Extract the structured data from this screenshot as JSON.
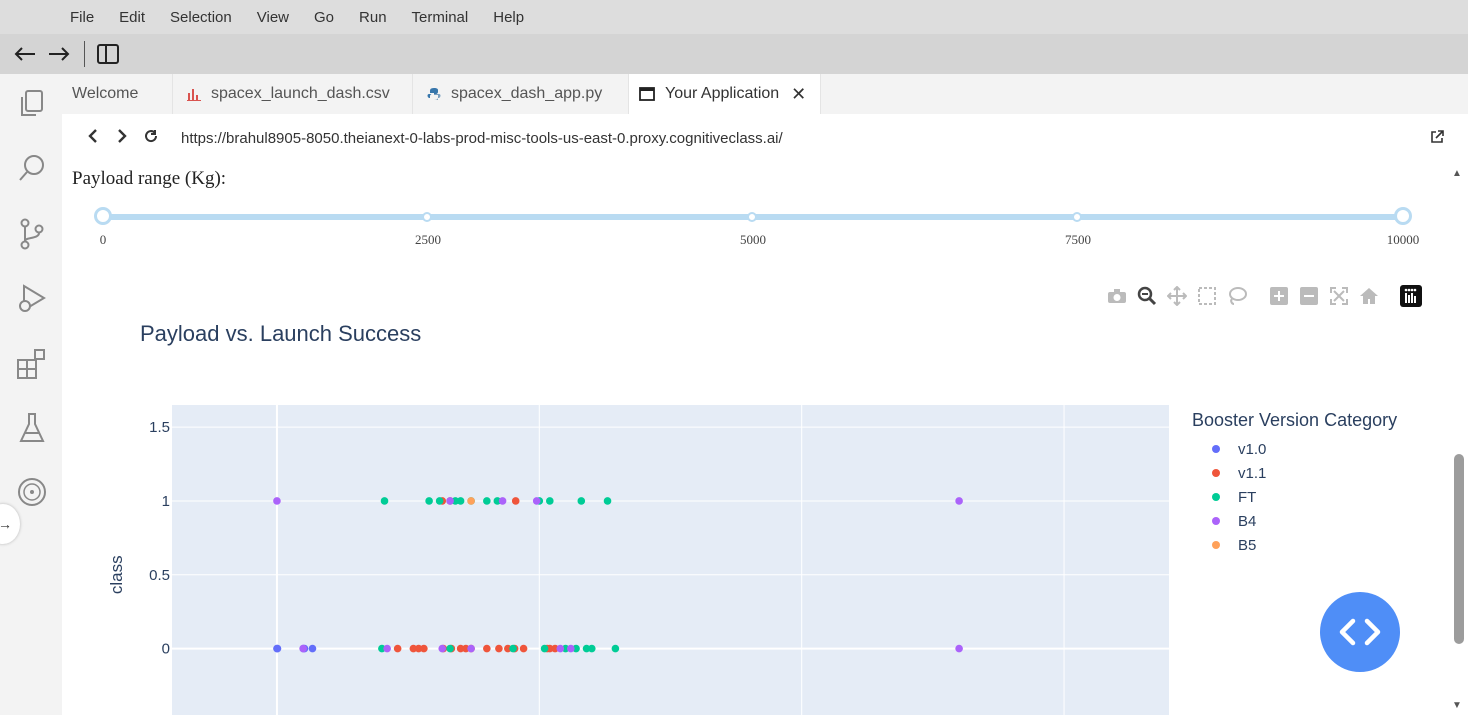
{
  "menubar": {
    "items": [
      "File",
      "Edit",
      "Selection",
      "View",
      "Go",
      "Run",
      "Terminal",
      "Help"
    ]
  },
  "tabs": [
    {
      "label": "Welcome",
      "icon": "none"
    },
    {
      "label": "spacex_launch_dash.csv",
      "icon": "chart-file-icon"
    },
    {
      "label": "spacex_dash_app.py",
      "icon": "python-icon"
    },
    {
      "label": "Your Application",
      "icon": "browser-window-icon",
      "active": true
    }
  ],
  "browser": {
    "url": "https://brahul8905-8050.theianext-0-labs-prod-misc-tools-us-east-0.proxy.cognitiveclass.ai/"
  },
  "payload_label": "Payload range (Kg):",
  "slider": {
    "min": 0,
    "max": 10000,
    "marks": [
      "0",
      "2500",
      "5000",
      "7500",
      "10000"
    ],
    "value": [
      0,
      10000
    ]
  },
  "colors": {
    "v1.0": "#636efa",
    "v1.1": "#ef553b",
    "FT": "#00cc96",
    "B4": "#ab63fa",
    "B5": "#ffa15a"
  },
  "chart_data": {
    "type": "scatter",
    "title": "Payload vs. Launch Success",
    "xlabel": "",
    "ylabel": "class",
    "xlim": [
      -2000,
      17000
    ],
    "ylim": [
      -0.45,
      1.65
    ],
    "yticks": [
      "1.5",
      "1",
      "0.5",
      "0"
    ],
    "legend_title": "Booster Version Category",
    "series": [
      {
        "name": "v1.0",
        "points": [
          [
            0,
            0
          ],
          [
            10,
            0
          ],
          [
            525,
            0
          ],
          [
            500,
            0
          ],
          [
            677,
            0
          ]
        ]
      },
      {
        "name": "v1.1",
        "points": [
          [
            2300,
            0
          ],
          [
            2700,
            0
          ],
          [
            3170,
            0
          ],
          [
            3325,
            0
          ],
          [
            3600,
            0
          ],
          [
            3700,
            0
          ],
          [
            4000,
            0
          ],
          [
            4230,
            0
          ],
          [
            4400,
            0
          ],
          [
            4530,
            0
          ],
          [
            4550,
            1
          ],
          [
            4700,
            0
          ],
          [
            5150,
            0
          ],
          [
            5200,
            0
          ],
          [
            5300,
            0
          ],
          [
            2600,
            0
          ],
          [
            2800,
            0
          ],
          [
            3500,
            0
          ],
          [
            3300,
            1
          ],
          [
            3150,
            1
          ]
        ]
      },
      {
        "name": "FT",
        "points": [
          [
            2000,
            0
          ],
          [
            3300,
            0
          ],
          [
            3500,
            1
          ],
          [
            4000,
            1
          ],
          [
            4500,
            0
          ],
          [
            5200,
            1
          ],
          [
            5500,
            0
          ],
          [
            5700,
            0
          ],
          [
            6000,
            0
          ],
          [
            6300,
            1
          ],
          [
            6450,
            0
          ],
          [
            2050,
            1
          ],
          [
            2900,
            1
          ],
          [
            3100,
            1
          ],
          [
            3400,
            1
          ],
          [
            3700,
            1
          ],
          [
            4200,
            1
          ],
          [
            5800,
            1
          ],
          [
            5900,
            0
          ],
          [
            5100,
            0
          ],
          [
            5000,
            1
          ]
        ]
      },
      {
        "name": "B4",
        "points": [
          [
            0,
            1
          ],
          [
            500,
            0
          ],
          [
            4300,
            1
          ],
          [
            3700,
            0
          ],
          [
            3300,
            1
          ],
          [
            2100,
            0
          ],
          [
            4950,
            1
          ],
          [
            5400,
            0
          ],
          [
            5600,
            0
          ],
          [
            13000,
            0
          ],
          [
            13000,
            1
          ],
          [
            3150,
            0
          ]
        ]
      },
      {
        "name": "B5",
        "points": [
          [
            3700,
            1
          ]
        ]
      }
    ]
  }
}
